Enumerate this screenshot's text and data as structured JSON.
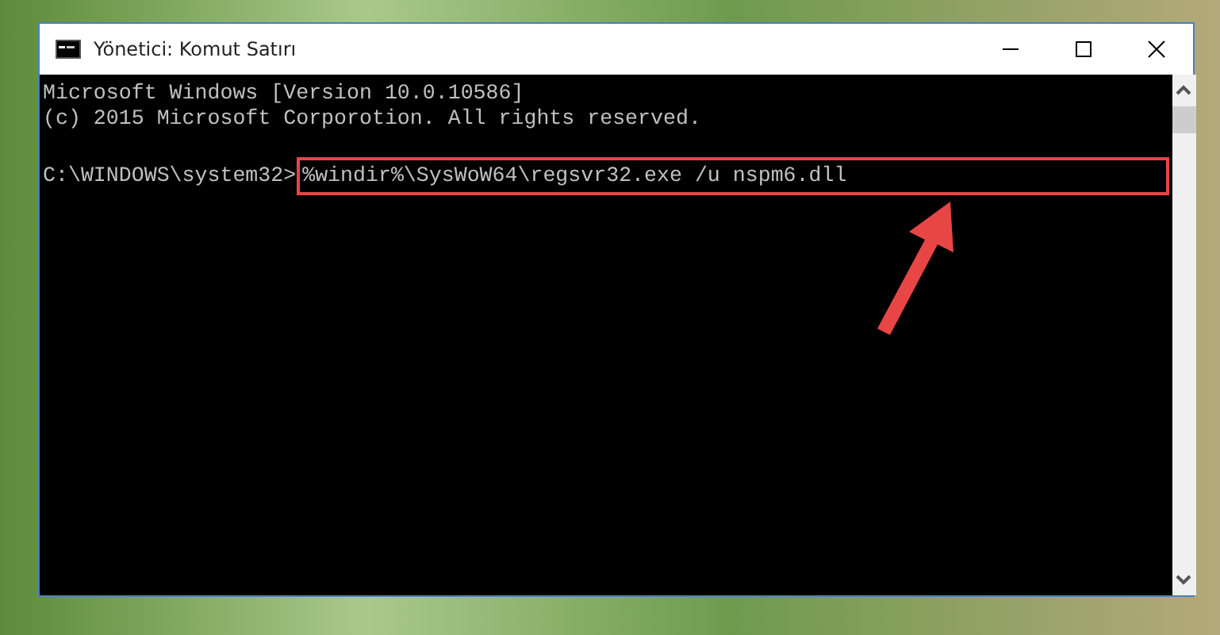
{
  "window": {
    "title": "Yönetici: Komut Satırı"
  },
  "console": {
    "lines": [
      "Microsoft Windows [Version 10.0.10586]",
      "(c) 2015 Microsoft Corporotion. All rights reserved."
    ],
    "prompt": "C:\\WINDOWS\\system32>",
    "command": "%windir%\\SysWoW64\\regsvr32.exe /u nspm6.dll"
  }
}
